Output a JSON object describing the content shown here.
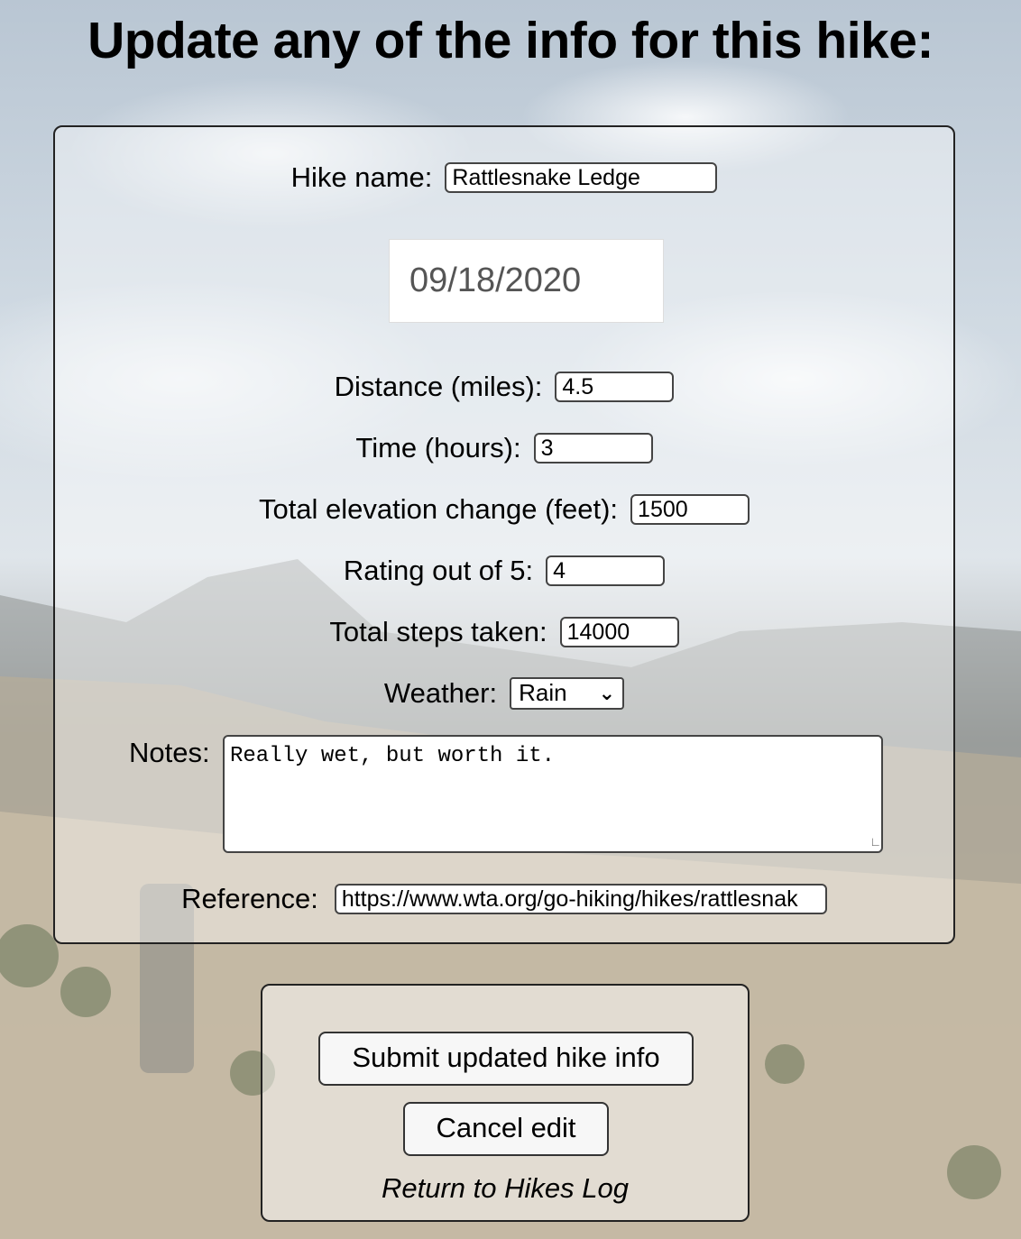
{
  "page": {
    "heading": "Update any of the info for this hike:"
  },
  "form": {
    "hike_name": {
      "label": "Hike name:",
      "value": "Rattlesnake Ledge"
    },
    "date": {
      "value": "09/18/2020"
    },
    "distance": {
      "label": "Distance (miles):",
      "value": "4.5"
    },
    "time": {
      "label": "Time (hours):",
      "value": "3"
    },
    "elevation": {
      "label": "Total elevation change (feet):",
      "value": "1500"
    },
    "rating": {
      "label": "Rating out of 5:",
      "value": "4"
    },
    "steps": {
      "label": "Total steps taken:",
      "value": "14000"
    },
    "weather": {
      "label": "Weather:",
      "selected": "Rain"
    },
    "notes": {
      "label": "Notes:",
      "value": "Really wet, but worth it."
    },
    "reference": {
      "label": "Reference:",
      "value": "https://www.wta.org/go-hiking/hikes/rattlesnak"
    }
  },
  "actions": {
    "submit_label": "Submit updated hike info",
    "cancel_label": "Cancel edit",
    "return_link": "Return to Hikes Log"
  },
  "icons": {
    "select_arrow": "chevron-down-icon",
    "resize_grip": "resize-grip-icon"
  }
}
